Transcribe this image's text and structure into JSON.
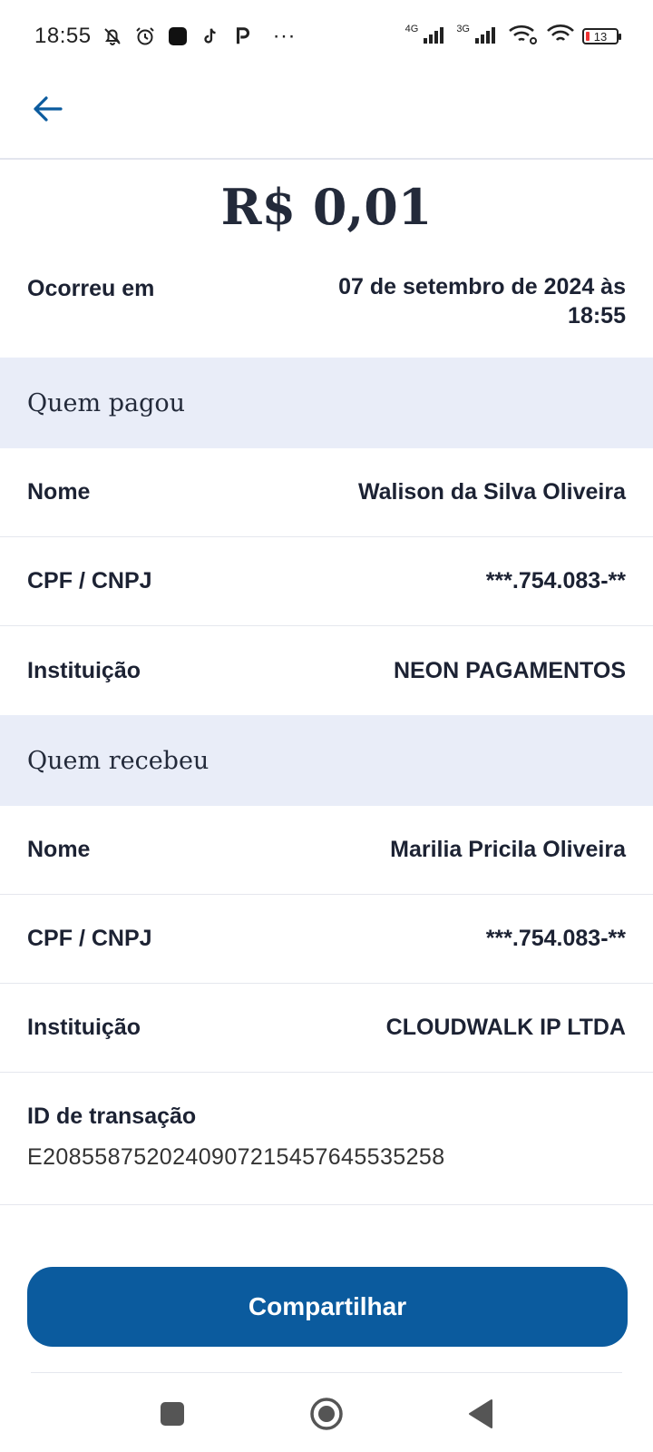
{
  "status_bar": {
    "time": "18:55",
    "overflow": "···",
    "net1": "4G",
    "net2": "3G",
    "battery": "13"
  },
  "amount": "R$ 0,01",
  "occurred": {
    "label": "Ocorreu em",
    "value": "07 de setembro de 2024 às 18:55"
  },
  "payer": {
    "title": "Quem pagou",
    "rows": [
      {
        "label": "Nome",
        "value": "Walison da Silva Oliveira"
      },
      {
        "label": "CPF / CNPJ",
        "value": "***.754.083-**"
      },
      {
        "label": "Instituição",
        "value": "NEON PAGAMENTOS"
      }
    ]
  },
  "receiver": {
    "title": "Quem recebeu",
    "rows": [
      {
        "label": "Nome",
        "value": "Marilia Pricila Oliveira"
      },
      {
        "label": "CPF / CNPJ",
        "value": "***.754.083-**"
      },
      {
        "label": "Instituição",
        "value": "CLOUDWALK IP LTDA"
      }
    ]
  },
  "transaction": {
    "label": "ID de transação",
    "value": "E20855875202409072154576455352​58"
  },
  "share_label": "Compartilhar",
  "icons": {
    "back": "arrow-left-icon",
    "nav_square": "recent-apps-icon",
    "nav_circle": "home-icon",
    "nav_triangle": "back-nav-icon"
  },
  "colors": {
    "accent": "#0b5b9e",
    "section_bg": "#e9edf8",
    "text": "#1c2233"
  }
}
